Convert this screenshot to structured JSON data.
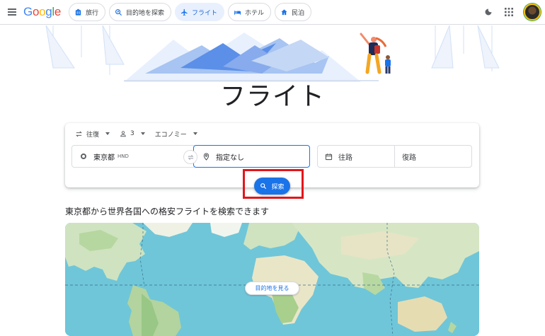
{
  "header": {
    "logo_text": "Google",
    "nav": [
      {
        "label": "旅行",
        "icon": "travel-bag-icon",
        "active": false
      },
      {
        "label": "目的地を探索",
        "icon": "explore-icon",
        "active": false
      },
      {
        "label": "フライト",
        "icon": "flight-icon",
        "active": true
      },
      {
        "label": "ホテル",
        "icon": "hotel-bed-icon",
        "active": false
      },
      {
        "label": "民泊",
        "icon": "home-icon",
        "active": false
      }
    ]
  },
  "page": {
    "title": "フライト"
  },
  "search": {
    "trip_type": "往復",
    "passengers": "3",
    "cabin_class": "エコノミー",
    "origin_city": "東京都",
    "origin_code": "HND",
    "destination": "指定なし",
    "depart_placeholder": "往路",
    "return_placeholder": "復路",
    "search_label": "探索"
  },
  "explore": {
    "title": "東京都から世界各国への格安フライトを検索できます",
    "map_button": "目的地を見る"
  },
  "colors": {
    "accent": "#1a73e8",
    "highlight": "#e2161b",
    "active_chip_bg": "#e8f0fe"
  }
}
